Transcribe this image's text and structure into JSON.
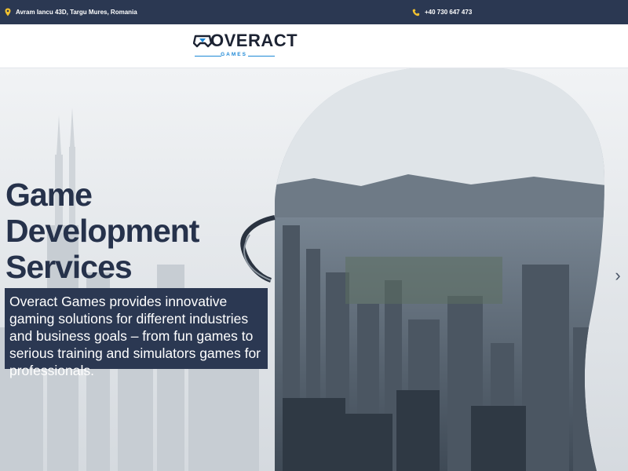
{
  "topbar": {
    "address": "Avram Iancu 43D, Targu Mures, Romania",
    "address_icon": "map-pin-icon",
    "phone": "+40 730 647 473",
    "phone_icon": "phone-icon"
  },
  "header": {
    "logo_text": "OVERACT",
    "logo_sub": "GAMES"
  },
  "hero": {
    "headline_lines": [
      "Game",
      "Development",
      "Services"
    ],
    "description": "Overact Games provides innovative gaming solutions for different industries and business goals – from fun games to serious training and simulators games for professionals.",
    "next_icon": "chevron-right-icon",
    "next_glyph": "›"
  },
  "colors": {
    "navy": "#2b3852",
    "accent_blue": "#1e88d6",
    "icon_yellow": "#f2c230",
    "headline": "#26324b"
  }
}
